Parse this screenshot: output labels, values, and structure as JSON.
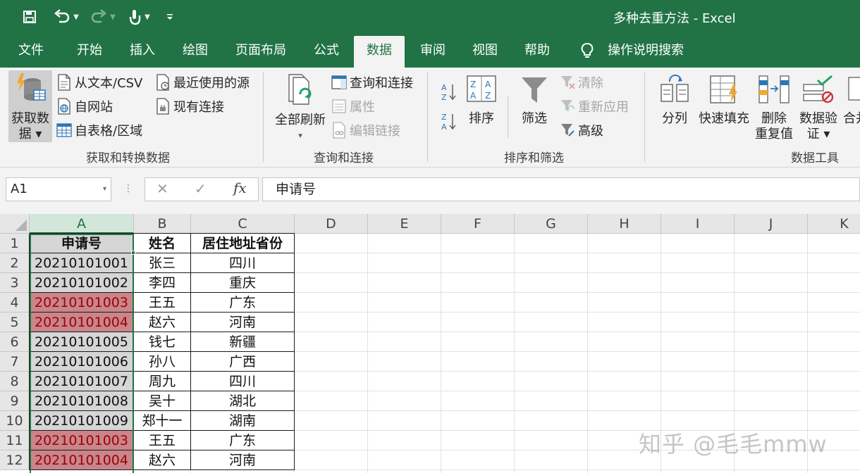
{
  "window": {
    "doc_title": "多种去重方法  -  Excel"
  },
  "quick_access": [
    "save-icon",
    "undo-icon",
    "redo-icon",
    "touch-mode-icon",
    "customize-icon"
  ],
  "tabs": [
    {
      "label": "文件",
      "active": false
    },
    {
      "label": "开始",
      "active": false
    },
    {
      "label": "插入",
      "active": false
    },
    {
      "label": "绘图",
      "active": false
    },
    {
      "label": "页面布局",
      "active": false
    },
    {
      "label": "公式",
      "active": false
    },
    {
      "label": "数据",
      "active": true
    },
    {
      "label": "审阅",
      "active": false
    },
    {
      "label": "视图",
      "active": false
    },
    {
      "label": "帮助",
      "active": false
    },
    {
      "label": "操作说明搜索",
      "active": false
    }
  ],
  "ribbon": {
    "get_data": {
      "line1": "获取数",
      "line2": "据 ▾"
    },
    "from_text_csv": "从文本/CSV",
    "from_web": "自网站",
    "from_table": "自表格/区域",
    "recent_sources": "最近使用的源",
    "existing_connections": "现有连接",
    "group_get_transform": "获取和转换数据",
    "refresh_all": "全部刷新",
    "refresh_caret": "▾",
    "queries_connections": "查询和连接",
    "properties": "属性",
    "edit_links": "编辑链接",
    "group_queries": "查询和连接",
    "sort": "排序",
    "filter": "筛选",
    "clear": "清除",
    "reapply": "重新应用",
    "advanced": "高级",
    "group_sort_filter": "排序和筛选",
    "text_to_columns": "分列",
    "flash_fill": "快速填充",
    "remove_duplicates_1": "删除",
    "remove_duplicates_2": "重复值",
    "data_validation_1": "数据验",
    "data_validation_2": "证 ▾",
    "consolidate": "合并",
    "group_data_tools": "数据工具"
  },
  "formula_bar": {
    "name_box": "A1",
    "name_box_caret": "▾",
    "dots": "⋮",
    "cancel": "✕",
    "enter": "✓",
    "fx": "fx",
    "content": "申请号"
  },
  "columns": [
    "A",
    "B",
    "C",
    "D",
    "E",
    "F",
    "G",
    "H",
    "I",
    "J",
    "K"
  ],
  "rows": [
    "1",
    "2",
    "3",
    "4",
    "5",
    "6",
    "7",
    "8",
    "9",
    "10",
    "11",
    "12"
  ],
  "table": {
    "header": [
      "申请号",
      "姓名",
      "居住地址省份"
    ],
    "records": [
      {
        "id": "20210101001",
        "name": "张三",
        "prov": "四川",
        "dup": false
      },
      {
        "id": "20210101002",
        "name": "李四",
        "prov": "重庆",
        "dup": false
      },
      {
        "id": "20210101003",
        "name": "王五",
        "prov": "广东",
        "dup": true
      },
      {
        "id": "20210101004",
        "name": "赵六",
        "prov": "河南",
        "dup": true
      },
      {
        "id": "20210101005",
        "name": "钱七",
        "prov": "新疆",
        "dup": false
      },
      {
        "id": "20210101006",
        "name": "孙八",
        "prov": "广西",
        "dup": false
      },
      {
        "id": "20210101007",
        "name": "周九",
        "prov": "四川",
        "dup": false
      },
      {
        "id": "20210101008",
        "name": "吴十",
        "prov": "湖北",
        "dup": false
      },
      {
        "id": "20210101009",
        "name": "郑十一",
        "prov": "湖南",
        "dup": false
      },
      {
        "id": "20210101003",
        "name": "王五",
        "prov": "广东",
        "dup": true
      },
      {
        "id": "20210101004",
        "name": "赵六",
        "prov": "河南",
        "dup": true
      }
    ]
  },
  "watermark": "知乎 @毛毛mmw",
  "colors": {
    "accent": "#217346",
    "dup_fill": "#d9a0a3",
    "dup_text": "#9c0006"
  }
}
